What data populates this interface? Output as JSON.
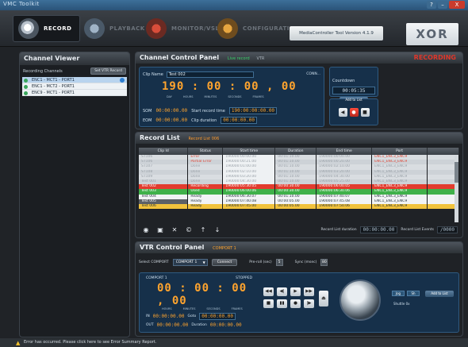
{
  "window": {
    "title": "VMC Toolkit",
    "help": "?",
    "minimize": "–",
    "close": "X"
  },
  "nav": {
    "record": "RECORD",
    "playback": "PLAYBACK",
    "monitor": "MONITOR/VSL",
    "config": "CONFIGURATION",
    "version": "MediaController Tool Version 4.1.9",
    "logo": "XOR"
  },
  "channel_viewer": {
    "title": "Channel Viewer",
    "recording_channels": "Recording Channels",
    "set_vtr": "Set VTR Record",
    "channels": [
      "ENC1 - MCT1 - PORT1",
      "ENC1 - MCT2 - PORT1",
      "ENC9 - MCT1 - PORT1"
    ]
  },
  "channel_control": {
    "title": "Channel Control Panel",
    "mode": "Live record",
    "mode2": "VTR",
    "status": "RECORDING",
    "clip_name_label": "Clip Name",
    "clip_name": "Test 002",
    "conn": "CONN...",
    "timecode": "190 : 00 : 00 , 00",
    "tc_labels": [
      "DAY",
      "HOURS",
      "MINUTES",
      "SECONDS",
      "FRAMES"
    ],
    "som_label": "SOM",
    "som": "00:00:00.00",
    "start_label": "Start record time",
    "start": "190:00:00:00.00",
    "eom_label": "EOM",
    "eom": "00:00:00.00",
    "dur_label": "Clip duration",
    "dur": "00:00:00.00",
    "countdown_label": "Countdown",
    "countdown": "00:05:35",
    "add_to_list": "Add to List",
    "t_rew": "◀",
    "t_rec": "●",
    "t_stop": "■"
  },
  "record_list": {
    "title": "Record List",
    "list_name": "Record List 006",
    "columns": [
      "Clip Id",
      "Status",
      "Start time",
      "Duration",
      "End time",
      "Port"
    ],
    "rows": [
      {
        "kind": "done",
        "id": "ST106",
        "status": "Error",
        "start": "190000:00:00.00",
        "dur": "00:01:10.00",
        "end": "190000:00:00.00",
        "port": "ENC1_ENC3_ENC9",
        "err": true
      },
      {
        "kind": "done alt",
        "id": "ST106",
        "status": "Partial Error",
        "start": "190000:00:21.00",
        "dur": "00:01:10.00",
        "end": "190000:00:20.00",
        "port": "ENC1_ENC3_ENC9",
        "err": true
      },
      {
        "kind": "done",
        "id": "ST107",
        "status": "Done",
        "start": "190000:01:00.00",
        "dur": "00:01:10.00",
        "end": "190000:02:10.00",
        "port": "ENC1_ENC3_ENC9",
        "err": false
      },
      {
        "kind": "done alt",
        "id": "ST108",
        "status": "Done",
        "start": "190000:02:10.00",
        "dur": "00:01:10.00",
        "end": "190000:03:20.00",
        "port": "ENC1_ENC3_ENC9",
        "err": false
      },
      {
        "kind": "done",
        "id": "ST109",
        "status": "Done",
        "start": "190000:03:20.00",
        "dur": "00:01:10.00",
        "end": "190000:04:30.00",
        "port": "ENC1_ENC3_ENC9",
        "err": false
      },
      {
        "kind": "done alt",
        "id": "Test 001",
        "status": "Done",
        "start": "190000:04:30.00",
        "dur": "00:01:10.00",
        "end": "190000:05:25.00",
        "port": "ENC1_ENC3_ENC9",
        "err": false
      },
      {
        "kind": "recording",
        "id": "Test 002",
        "status": "Recording",
        "start": "190000:05:30.05",
        "dur": "00:00:30.00",
        "end": "190000:06:00.05",
        "port": "ENC1_ENC3_ENC9",
        "err": false
      },
      {
        "kind": "used",
        "id": "Test 003",
        "status": "Used",
        "start": "190000:06:00.06",
        "dur": "00:00:30.00",
        "end": "190000:06:30.06",
        "port": "ENC1_ENC3_ENC9",
        "err": false
      },
      {
        "kind": "ready",
        "id": "Test 004",
        "status": "Ready",
        "start": "190000:06:30.07",
        "dur": "00:01:10.00",
        "end": "190000:07:40.07",
        "port": "ENC1_ENC3_ENC9",
        "err": false
      },
      {
        "kind": "ready ident",
        "id": "Test 005",
        "status": "Ready",
        "start": "190000:07:40.08",
        "dur": "00:00:05.00",
        "end": "190000:07:45.08",
        "port": "ENC1_ENC3_ENC9",
        "err": false
      },
      {
        "kind": "ready yel",
        "id": "Test 006",
        "status": "Ready",
        "start": "190000:07:45.00",
        "dur": "00:00:05.00",
        "end": "190000:07:50.06",
        "port": "ENC1_ENC3_ENC9",
        "err": false
      }
    ],
    "duration_label": "Record List duration",
    "duration": "00:00:00.00",
    "events_label": "Record List Events",
    "events": "/0000"
  },
  "vtr": {
    "title": "VTR Control Panel",
    "port": "COMPORT 1",
    "select_label": "Select COMPORT",
    "select_value": "COMPORT 1",
    "connect": "Connect",
    "preroll_label": "Pre-roll (sec)",
    "preroll": "5",
    "sync_label": "Sync (msec)",
    "sync": "80",
    "status": "STOPPED",
    "timecode": "00 : 00 : 00 , 00",
    "tc_labels": [
      "HOURS",
      "MINUTES",
      "SECONDS",
      "FRAMES"
    ],
    "in_label": "IN",
    "in": "00:00:00.00",
    "goto_label": "Goto",
    "goto": "00:00:00.00",
    "out_label": "OUT",
    "out": "00:00:00.00",
    "dur_label": "Duration",
    "dur": "00:00:00.00",
    "jog": "Jog",
    "shuttle": "Sh",
    "shuttle_label": "Shuttle 0x",
    "add_to_list": "Add to List"
  },
  "status_bar": {
    "message": "Error has occurred. Please click here to see Error Summary Report."
  },
  "colors": {
    "recording": "#e23b2e",
    "used": "#3fb14a",
    "ready_highlight": "#f1c23c",
    "timecode": "#ffa42e"
  }
}
